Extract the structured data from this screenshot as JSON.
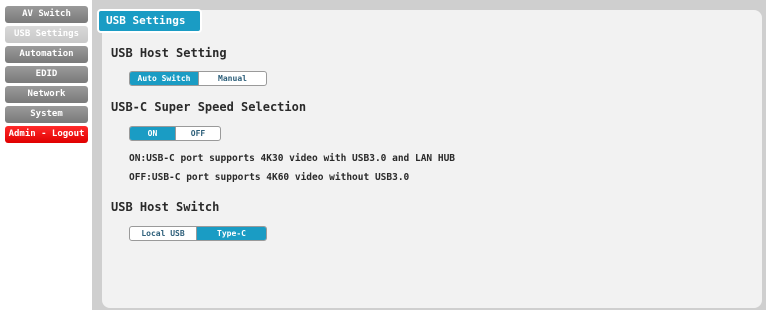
{
  "sidebar": {
    "items": [
      {
        "label": "AV Switch"
      },
      {
        "label": "USB Settings"
      },
      {
        "label": "Automation"
      },
      {
        "label": "EDID"
      },
      {
        "label": "Network"
      },
      {
        "label": "System"
      },
      {
        "label": "Admin - Logout"
      }
    ],
    "active_index": 1
  },
  "page": {
    "title": "USB Settings"
  },
  "usb_host_setting": {
    "title": "USB Host Setting",
    "options": [
      "Auto Switch",
      "Manual"
    ],
    "selected": "Auto Switch"
  },
  "usbc_speed": {
    "title": "USB-C Super Speed Selection",
    "options": [
      "ON",
      "OFF"
    ],
    "selected": "ON",
    "desc_on": "ON:USB-C port supports 4K30 video with USB3.0 and LAN HUB",
    "desc_off": "OFF:USB-C port supports 4K60 video without USB3.0"
  },
  "usb_host_switch": {
    "title": "USB Host Switch",
    "options": [
      "Local USB",
      "Type-C"
    ],
    "selected": "Type-C"
  },
  "colors": {
    "accent": "#1a9cc4",
    "logout": "#ff0000",
    "nav": "#8a8a8a",
    "panel": "#f2f2f2"
  }
}
